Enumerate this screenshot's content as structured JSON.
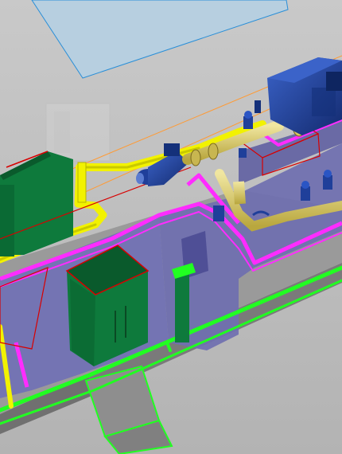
{
  "scene": {
    "kind": "3d-plant-model-viewport",
    "visible_text": [],
    "colors": {
      "background": "#bdbdbd",
      "floor_plate": "#9c9c9c",
      "platform_side": "#7f7f7f",
      "wall_translucent": "#6f6fb0",
      "wall_dark": "#5b5ba0",
      "cabinet_green": "#0e7a3c",
      "cabinet_dark": "#0a5a2c",
      "yellow_pipe": "#f2f200",
      "pipe_tan": "#d8c86a",
      "magenta_pipe": "#ff2cff",
      "bright_green_rail": "#21ff21",
      "blue_equipment": "#1f3f9a",
      "navy_equipment": "#14307a",
      "selection_outline": "#d80000",
      "guide_line": "#ff9a33",
      "plane_fill": "#b7cfe0",
      "plane_edge": "#2a8fd8"
    },
    "icons": [
      "valve-icon",
      "motor-icon",
      "pump-icon"
    ]
  }
}
